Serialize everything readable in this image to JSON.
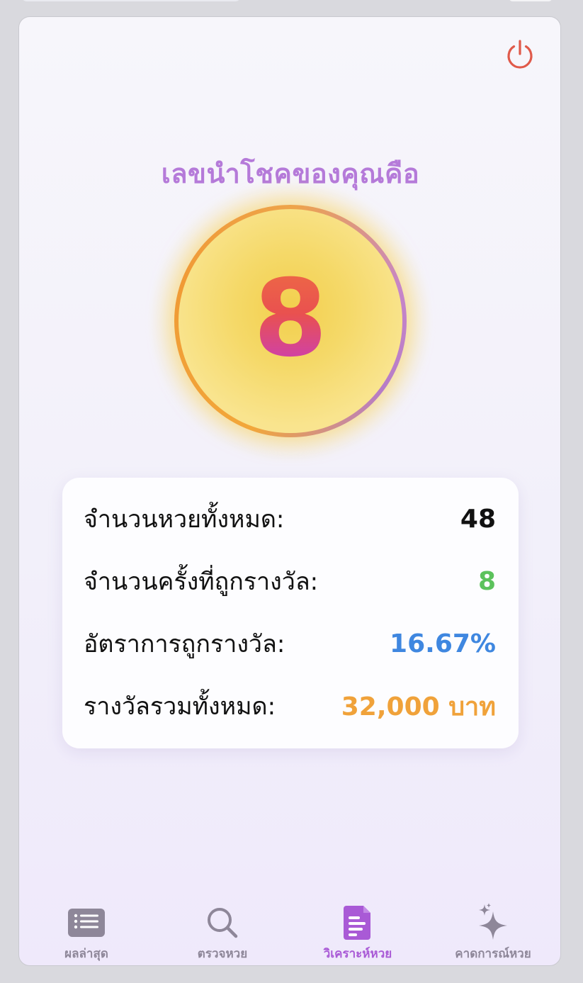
{
  "header": {
    "headline": "เลขนำโชคของคุณคือ"
  },
  "lucky": {
    "number": "8"
  },
  "stats": [
    {
      "label": "จำนวนหวยทั้งหมด:",
      "value": "48",
      "color": "#111111"
    },
    {
      "label": "จำนวนครั้งที่ถูกรางวัล:",
      "value": "8",
      "color": "#5cc25c"
    },
    {
      "label": "อัตราการถูกรางวัล:",
      "value": "16.67%",
      "color": "#3f87e0"
    },
    {
      "label": "รางวัลรวมทั้งหมด:",
      "value": "32,000 บาท",
      "color": "#f0a23a"
    }
  ],
  "tabs": [
    {
      "label": "ผลล่าสุด",
      "icon": "list-icon",
      "active": false
    },
    {
      "label": "ตรวจหวย",
      "icon": "search-icon",
      "active": false
    },
    {
      "label": "วิเคราะห์หวย",
      "icon": "document-analysis-icon",
      "active": true
    },
    {
      "label": "คาดการณ์หวย",
      "icon": "sparkles-icon",
      "active": false
    }
  ],
  "colors": {
    "accent": "#a95ad6",
    "headline": "#b57ad9",
    "power": "#e05a4a",
    "tab_inactive": "#8e8799"
  }
}
